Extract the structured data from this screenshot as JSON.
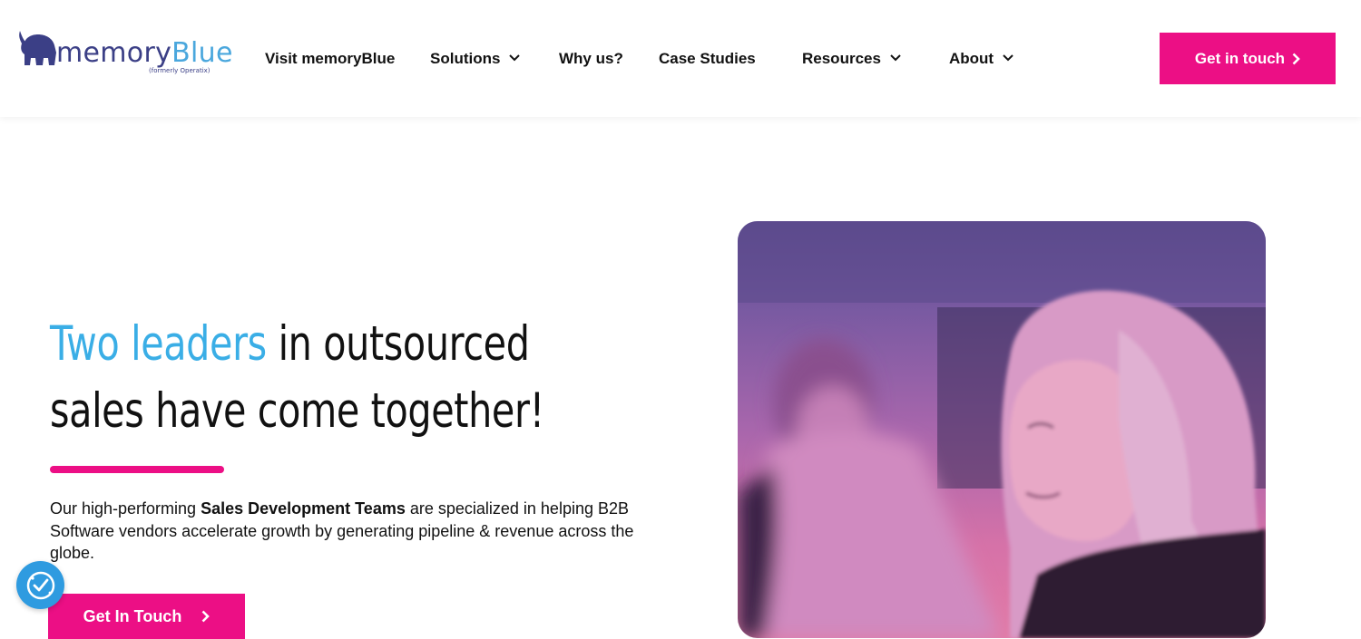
{
  "header": {
    "logo": {
      "word_main": "memory",
      "word_accent": "Blue",
      "subtitle": "(formerly Operatix)"
    },
    "nav": [
      {
        "label": "Visit memoryBlue",
        "has_dropdown": false
      },
      {
        "label": "Solutions",
        "has_dropdown": true
      },
      {
        "label": "Why us?",
        "has_dropdown": false
      },
      {
        "label": "Case Studies",
        "has_dropdown": false
      },
      {
        "label": "Resources",
        "has_dropdown": true
      },
      {
        "label": "About",
        "has_dropdown": true
      }
    ],
    "cta_label": "Get in touch"
  },
  "hero": {
    "title_accent": "Two leaders",
    "title_rest_line1": " in outsourced",
    "title_line2": "sales have come together!",
    "desc_part1": "Our high-performing ",
    "desc_bold": "Sales Development Teams",
    "desc_part2": " are specialized in helping B2B Software vendors accelerate growth by generating pipeline & revenue across the globe.",
    "cta_label": "Get In Touch"
  },
  "colors": {
    "brand_pink": "#ec0f85",
    "brand_blue": "#3aaee6",
    "logo_navy": "#3b3f86"
  },
  "icons": {
    "nav_dropdown": "chevron-down-icon",
    "cta_arrow": "chevron-right-icon",
    "accessibility": "accessibility-icon",
    "logo_mark": "elephant-icon"
  }
}
